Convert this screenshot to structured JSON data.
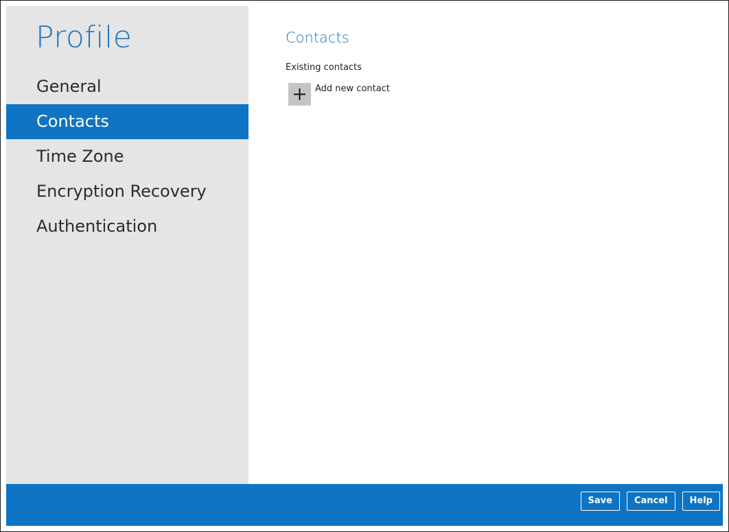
{
  "sidebar": {
    "title": "Profile",
    "items": [
      {
        "label": "General",
        "active": false
      },
      {
        "label": "Contacts",
        "active": true
      },
      {
        "label": "Time Zone",
        "active": false
      },
      {
        "label": "Encryption Recovery",
        "active": false
      },
      {
        "label": "Authentication",
        "active": false
      }
    ]
  },
  "main": {
    "section_title": "Contacts",
    "subheading": "Existing contacts",
    "add_contact_label": "Add new contact",
    "add_icon": "plus-icon"
  },
  "footer": {
    "save_label": "Save",
    "cancel_label": "Cancel",
    "help_label": "Help"
  },
  "colors": {
    "accent": "#0e74c3",
    "title": "#1e73be",
    "sidebar_bg": "#e5e5e5"
  }
}
